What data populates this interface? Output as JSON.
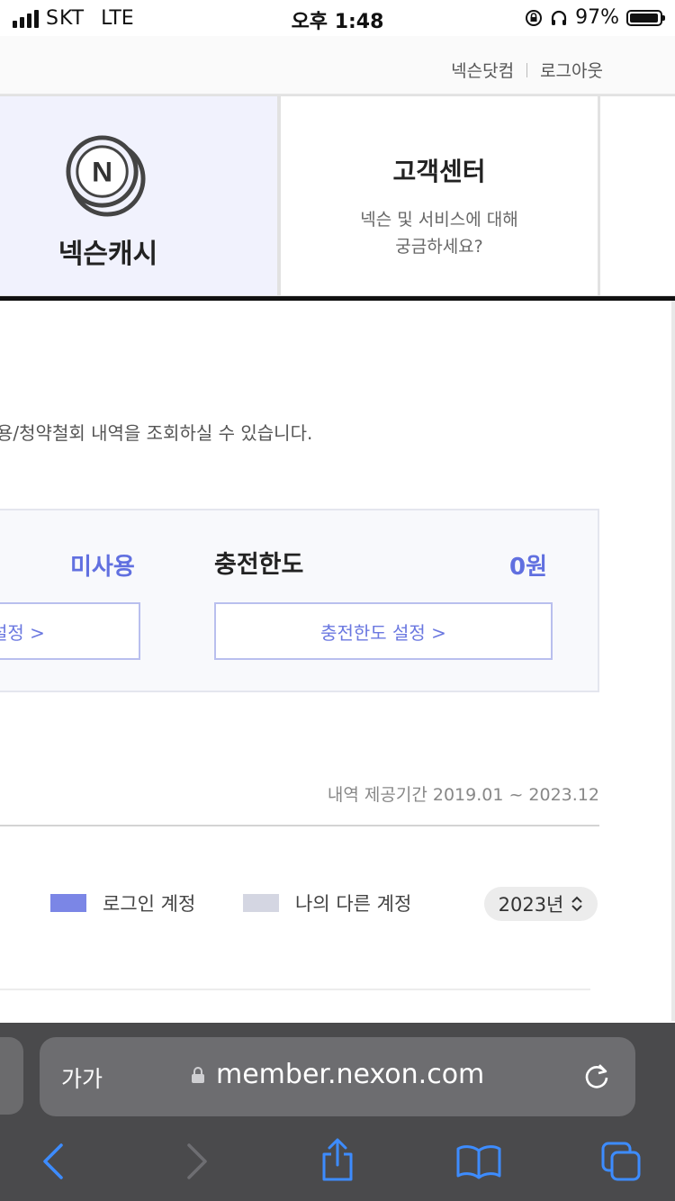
{
  "status_bar": {
    "carrier": "SKT",
    "network": "LTE",
    "time": "오후 1:48",
    "battery": "97%",
    "battery_level": 0.97
  },
  "top_links": {
    "nexon_link": "넥슨닷컴",
    "logout": "로그아웃"
  },
  "cards": {
    "cash": {
      "label": "넥슨캐시",
      "icon": "nexon-coin-icon",
      "logo_letter": "N"
    },
    "customer_center": {
      "title": "고객센터",
      "desc_line1": "넥슨 및 서비스에 대해",
      "desc_line2": "궁금하세요?"
    }
  },
  "intro_text": "용/청약철회 내역을 조회하실 수 있습니다.",
  "info_box": {
    "unused_status": "미사용",
    "limit_label": "충전한도",
    "limit_value": "0원",
    "left_button": "설정 >",
    "limit_button": "충전한도 설정 >"
  },
  "history_period": "내역 제공기간 2019.01 ~ 2023.12",
  "legend": {
    "logged_in": "로그인 계정",
    "other": "나의 다른 계정",
    "logged_in_color": "#7b86e6",
    "other_color": "#d4d6e2"
  },
  "year_select": {
    "value": "2023년"
  },
  "browser": {
    "aa": "가가",
    "url": "member.nexon.com"
  },
  "colors": {
    "accent": "#6170e0",
    "card_bg": "#f1f2fd",
    "browser_bar": "#4a4a4c",
    "browser_icon": "#3d8cff"
  }
}
